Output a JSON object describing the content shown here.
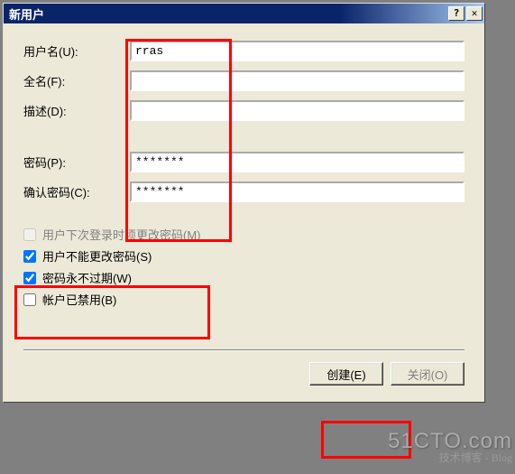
{
  "title": "新用户",
  "titlebar": {
    "help": "?",
    "close": "✕"
  },
  "labels": {
    "username": "用户名(U):",
    "fullname": "全名(F):",
    "description": "描述(D):",
    "password": "密码(P):",
    "confirm": "确认密码(C):"
  },
  "values": {
    "username": "rras",
    "fullname": "",
    "description": "",
    "password": "*******",
    "confirm": "*******"
  },
  "checkboxes": {
    "mustChange": {
      "label": "用户下次登录时须更改密码(M)",
      "checked": false,
      "enabled": false
    },
    "cannotChange": {
      "label": "用户不能更改密码(S)",
      "checked": true,
      "enabled": true
    },
    "neverExpire": {
      "label": "密码永不过期(W)",
      "checked": true,
      "enabled": true
    },
    "disabled": {
      "label": "帐户已禁用(B)",
      "checked": false,
      "enabled": true
    }
  },
  "buttons": {
    "create": "创建(E)",
    "close": "关闭(O)"
  },
  "watermark": {
    "line1": "51CTO.com",
    "line2": "技术博客 - Blog"
  }
}
